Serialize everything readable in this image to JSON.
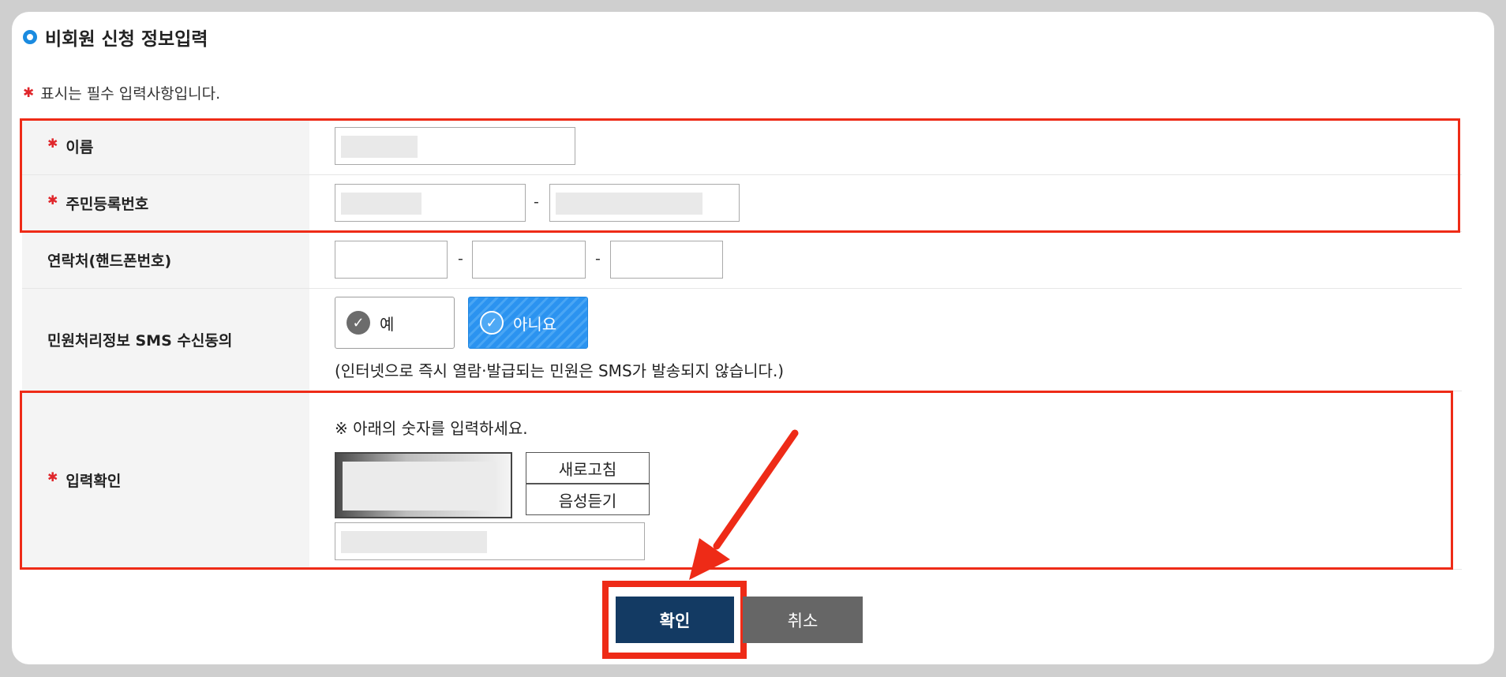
{
  "section": {
    "title": "비회원 신청 정보입력"
  },
  "required_note": {
    "star": "✱",
    "text": "표시는 필수 입력사항입니다."
  },
  "form": {
    "name_label": "이름",
    "rrn_label": "주민등록번호",
    "rrn_separator": "-",
    "phone_label": "연락처(핸드폰번호)",
    "phone_separator": "-",
    "sms_label": "민원처리정보 SMS 수신동의",
    "sms_yes": "예",
    "sms_no": "아니요",
    "sms_note": "(인터넷으로 즉시 열람·발급되는 민원은 SMS가 발송되지 않습니다.)",
    "captcha_label": "입력확인",
    "captcha_note": "※ 아래의 숫자를 입력하세요.",
    "refresh_label": "새로고침",
    "audio_label": "음성듣기"
  },
  "buttons": {
    "confirm": "확인",
    "cancel": "취소"
  },
  "icons": {
    "check": "check-icon",
    "required": "asterisk-icon",
    "section": "ring-bullet-icon"
  },
  "colors": {
    "accent": "#1a8be0",
    "highlight": "#ee2b17",
    "confirm_bg": "#133a63",
    "cancel_bg": "#666666",
    "required": "#e0262b"
  }
}
